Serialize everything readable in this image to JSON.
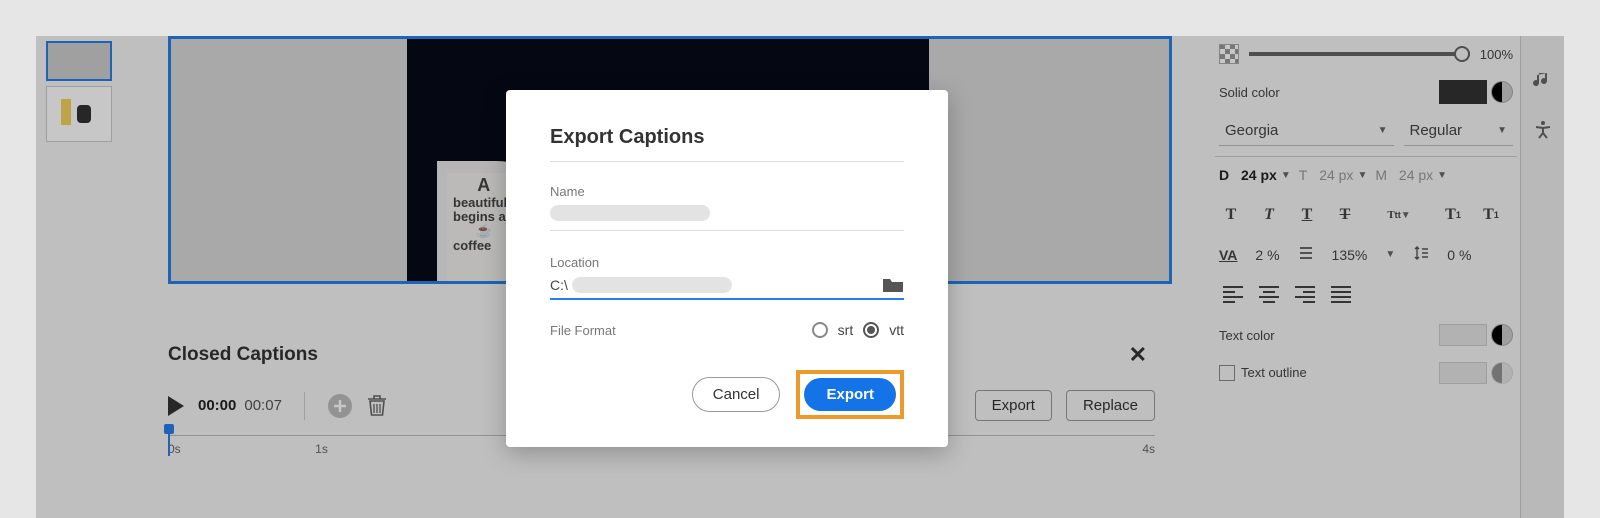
{
  "slider_value": "100%",
  "solid_color_label": "Solid color",
  "font": {
    "family": "Georgia",
    "weight": "Regular"
  },
  "sizes": {
    "d_label": "D",
    "d_val": "24 px",
    "t_label": "T",
    "t_val": "24 px",
    "m_label": "M",
    "m_val": "24 px"
  },
  "tracking_icon": "VA",
  "tracking_val": "2 %",
  "lineheight_val": "135%",
  "leading_val": "0 %",
  "text_color_label": "Text color",
  "text_outline_label": "Text outline",
  "captions": {
    "title": "Closed Captions",
    "time_start": "00:00",
    "time_end": "00:07",
    "export_btn": "Export",
    "replace_btn": "Replace",
    "ticks": [
      "0s",
      "1s",
      "4s"
    ]
  },
  "modal": {
    "title": "Export Captions",
    "name_label": "Name",
    "location_label": "Location",
    "location_prefix": "C:\\",
    "format_label": "File Format",
    "format_srt": "srt",
    "format_vtt": "vtt",
    "cancel": "Cancel",
    "export": "Export"
  },
  "mug_lines": [
    "A",
    "beautiful",
    "begins aft",
    "☕",
    "coffee"
  ]
}
